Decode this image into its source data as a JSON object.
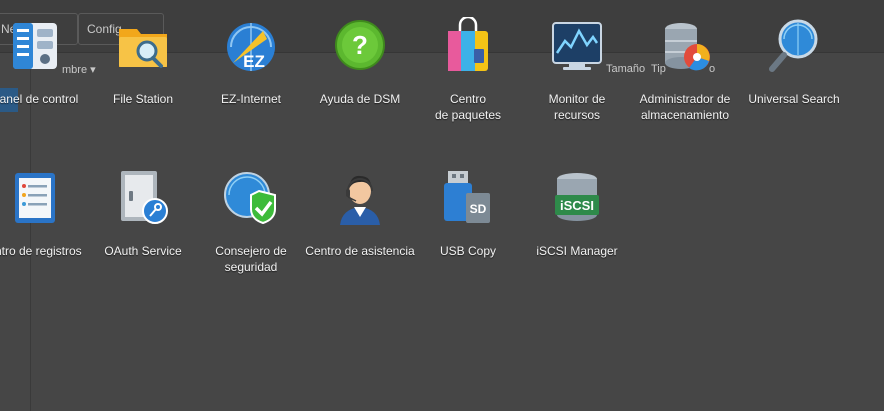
{
  "background_toolbar": {
    "button1_label": "Ne",
    "button2_label": "Config",
    "col_name": "mbre ▾",
    "col_size": "Tamaño",
    "col_type": "Tip",
    "col_other": "o"
  },
  "apps": [
    {
      "label": "Panel de control",
      "icon": "control-panel-icon"
    },
    {
      "label": "File Station",
      "icon": "file-station-icon"
    },
    {
      "label": "EZ-Internet",
      "icon": "ez-internet-icon"
    },
    {
      "label": "Ayuda de DSM",
      "icon": "help-icon"
    },
    {
      "label": "Centro\nde paquetes",
      "icon": "package-center-icon"
    },
    {
      "label": "Monitor de\nrecursos",
      "icon": "resource-monitor-icon"
    },
    {
      "label": "Administrador de\nalmacenamiento",
      "icon": "storage-manager-icon"
    },
    {
      "label": "Universal Search",
      "icon": "universal-search-icon"
    },
    {
      "label": "entro de registros",
      "icon": "log-center-icon"
    },
    {
      "label": "OAuth Service",
      "icon": "oauth-service-icon"
    },
    {
      "label": "Consejero de\nseguridad",
      "icon": "security-advisor-icon"
    },
    {
      "label": "Centro de asistencia",
      "icon": "support-center-icon"
    },
    {
      "label": "USB Copy",
      "icon": "usb-copy-icon"
    },
    {
      "label": "iSCSI Manager",
      "icon": "iscsi-manager-icon"
    }
  ],
  "icon_text": {
    "ez": "EZ",
    "help": "?",
    "usb": "SD",
    "iscsi": "iSCSI"
  }
}
